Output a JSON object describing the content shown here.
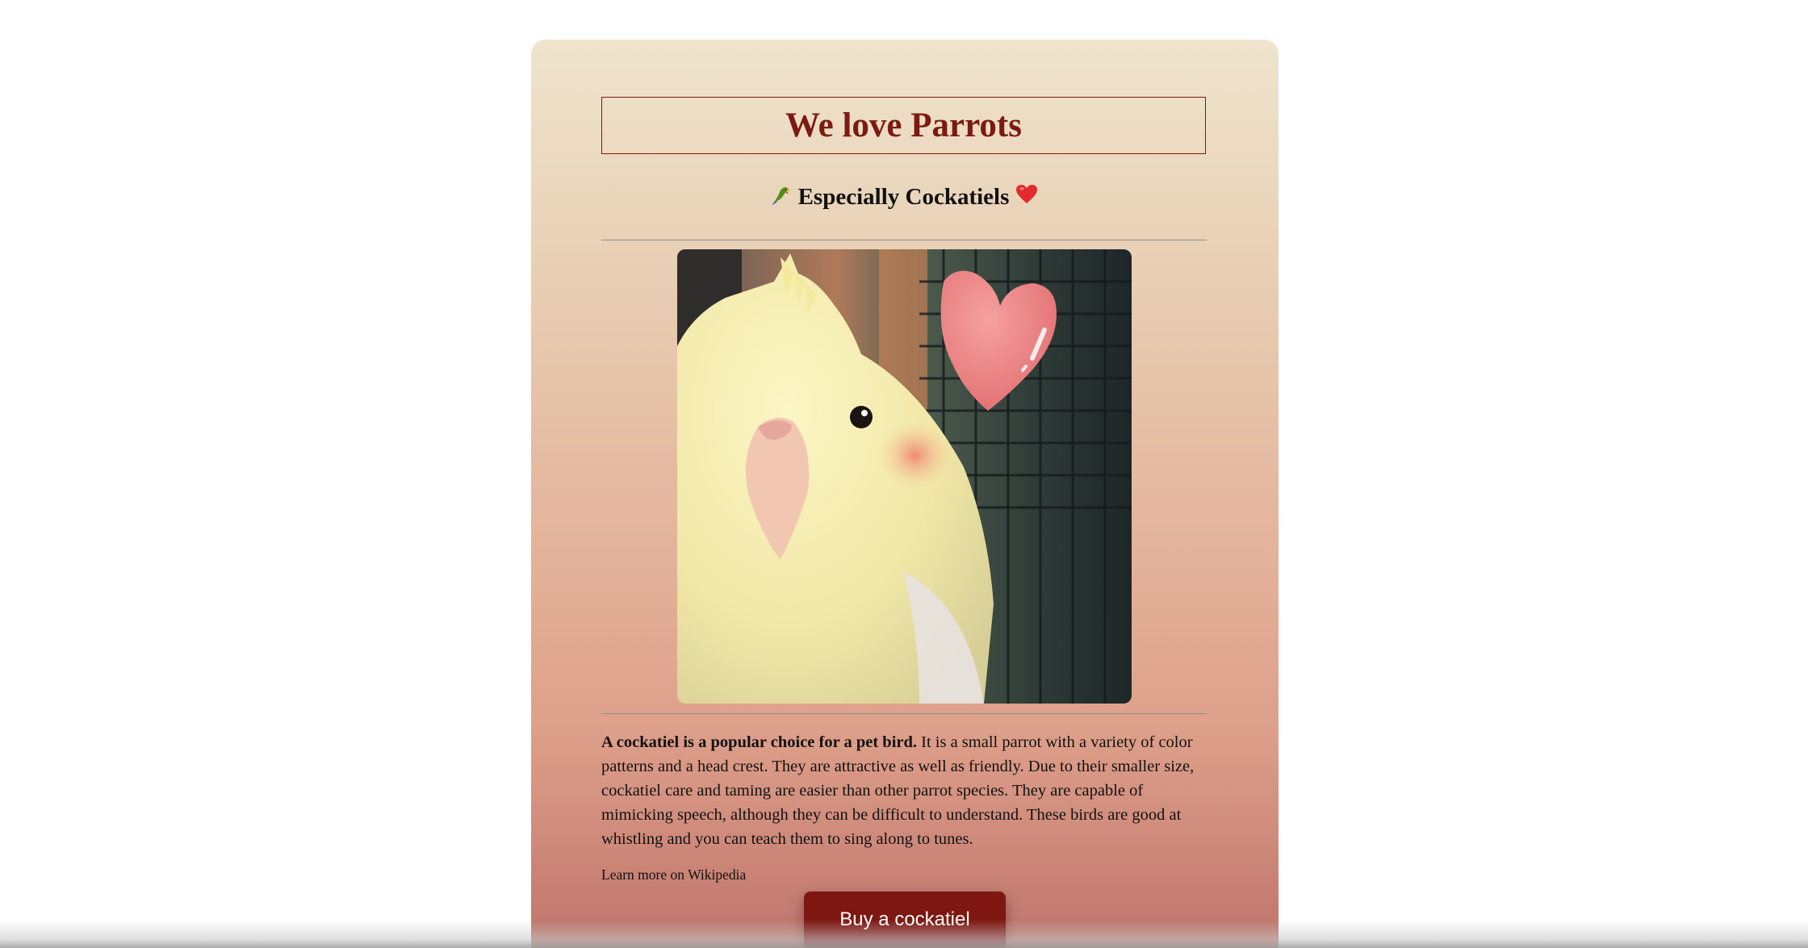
{
  "page": {
    "title": "We love Parrots",
    "subtitle": "Especially Cockatiels",
    "subtitle_left_icon": "parrot-emoji",
    "subtitle_right_icon": "red-heart-emoji"
  },
  "image": {
    "alt": "cockatiel-photo",
    "subject": "cockatiel-with-heart-sticker"
  },
  "article": {
    "lead": "A cockatiel is a popular choice for a pet bird.",
    "body": " It is a small parrot with a variety of color patterns and a head crest. They are attractive as well as friendly. Due to their smaller size, cockatiel care and taming are easier than other parrot species. They are capable of mimicking speech, although they can be difficult to understand. These birds are good at whistling and you can teach them to sing along to tunes."
  },
  "links": {
    "wikipedia": "Learn more on Wikipedia"
  },
  "actions": {
    "buy_label": "Buy a cockatiel"
  },
  "colors": {
    "title": "#7c1a12",
    "button": "#7e1712",
    "card_top": "#efe4cd",
    "card_bottom": "#b36a62"
  }
}
